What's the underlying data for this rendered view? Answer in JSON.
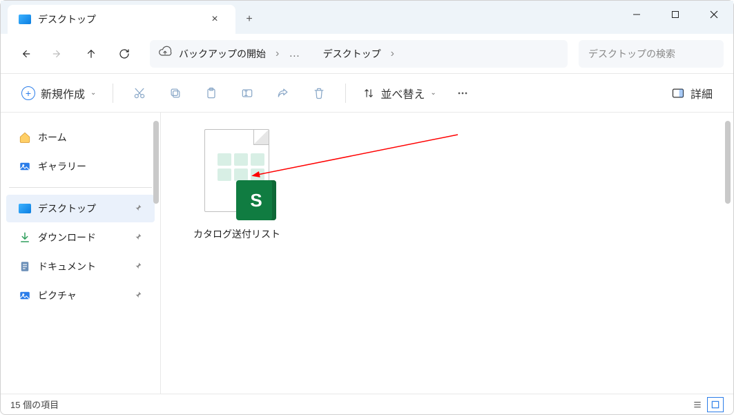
{
  "tab": {
    "title": "デスクトップ",
    "close": "×",
    "new": "+"
  },
  "window": {
    "min": "—",
    "max": "▢",
    "close": "✕"
  },
  "address": {
    "backup": "バックアップの開始",
    "current": "デスクトップ"
  },
  "search": {
    "placeholder": "デスクトップの検索"
  },
  "toolbar": {
    "new": "新規作成",
    "sort": "並べ替え",
    "details": "詳細"
  },
  "sidebar": {
    "home": "ホーム",
    "gallery": "ギャラリー",
    "desktop": "デスクトップ",
    "downloads": "ダウンロード",
    "documents": "ドキュメント",
    "pictures": "ピクチャ"
  },
  "file": {
    "name": "カタログ送付リスト",
    "badge": "S"
  },
  "status": {
    "count": "15 個の項目"
  }
}
